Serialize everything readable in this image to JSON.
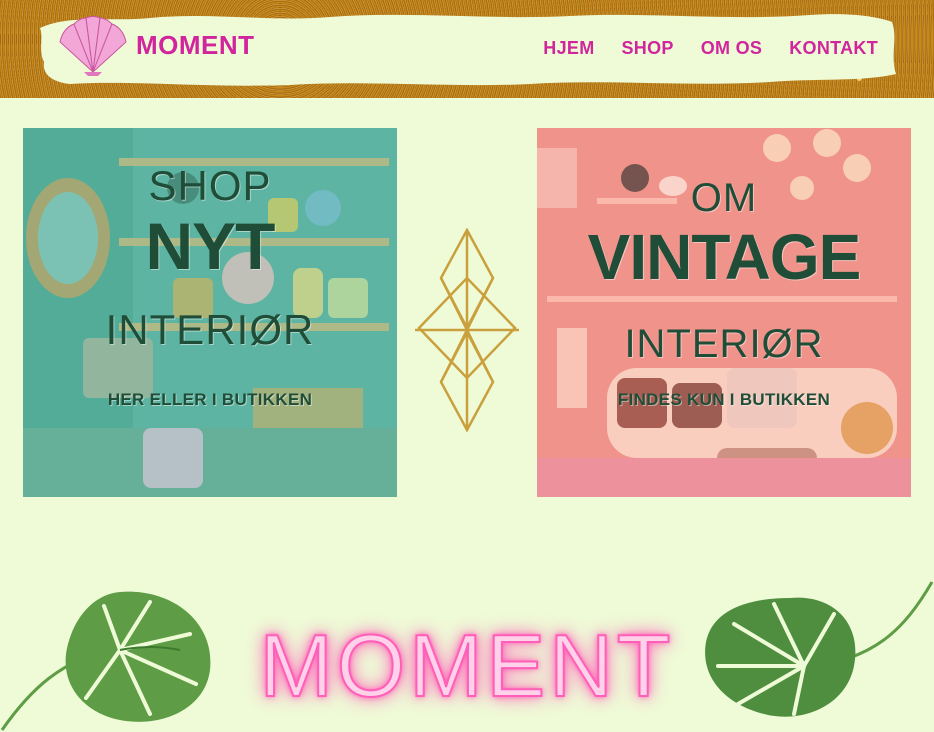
{
  "brand": {
    "name": "MOMENT"
  },
  "nav": {
    "items": [
      "HJEM",
      "SHOP",
      "OM OS",
      "KONTAKT"
    ]
  },
  "cards": {
    "left": {
      "line1": "SHOP",
      "line2": "NYT",
      "line3": "INTERIØR",
      "caption": "HER ELLER I BUTIKKEN"
    },
    "right": {
      "line1": "OM",
      "line2": "VINTAGE",
      "line3": "INTERIØR",
      "caption": "FINDES KUN I BUTIKKEN"
    }
  },
  "footer": {
    "neon_text": "MOMENT"
  },
  "colors": {
    "background": "#effbd7",
    "brand_pink": "#d0259c",
    "heading_green": "#1f4d37",
    "gold": "#c9a03c"
  }
}
